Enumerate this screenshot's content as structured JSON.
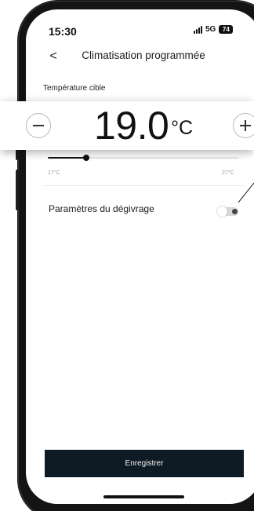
{
  "status_bar": {
    "time": "15:30",
    "network": "5G",
    "battery": "74",
    "signal_icon": "signal-bars-icon",
    "battery_icon": "battery-icon"
  },
  "header": {
    "back_icon": "chevron-left-icon",
    "back_glyph": "<",
    "title": "Climatisation programmée"
  },
  "temperature": {
    "label": "Température cible",
    "value": "19.0",
    "unit": "°C",
    "min_label": "17°C",
    "max_label": "27°C",
    "min_value": 17,
    "max_value": 27,
    "current_value": 19,
    "decrease_icon": "minus-icon",
    "increase_icon": "plus-icon"
  },
  "defrost": {
    "label": "Paramètres du dégivrage",
    "toggle_state": "off"
  },
  "footer": {
    "save_label": "Enregistrer"
  },
  "colors": {
    "primary_button": "#0e1a24",
    "slider_fill": "#111111",
    "slider_track": "#e4e4e4",
    "toggle_off": "#d9d9d9",
    "phone_frame": "#141414"
  }
}
